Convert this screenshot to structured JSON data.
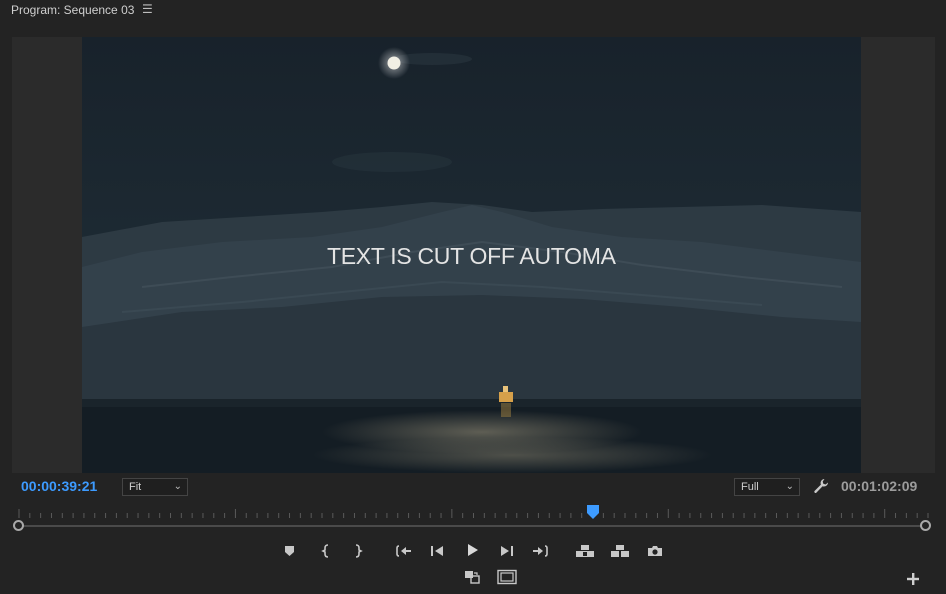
{
  "panel": {
    "title": "Program: Sequence 03",
    "menu_icon": "hamburger-icon"
  },
  "viewer": {
    "overlay_text": "TEXT IS CUT OFF AUTOMA",
    "colors": {
      "sky": "#1a2630",
      "water": "#141d24",
      "accent": "#3d9bff"
    }
  },
  "timecodes": {
    "current": "00:00:39:21",
    "duration": "00:01:02:09"
  },
  "zoom_select": {
    "value": "Fit"
  },
  "quality_select": {
    "value": "Full"
  },
  "playback_position": 0.632,
  "controls": [
    "add-marker-icon",
    "mark-in-icon",
    "mark-out-icon",
    "go-to-in-icon",
    "step-back-icon",
    "play-icon",
    "step-forward-icon",
    "go-to-out-icon",
    "lift-icon",
    "extract-icon",
    "export-frame-icon",
    "comparison-view-icon",
    "safe-margins-icon",
    "add-button-icon"
  ]
}
